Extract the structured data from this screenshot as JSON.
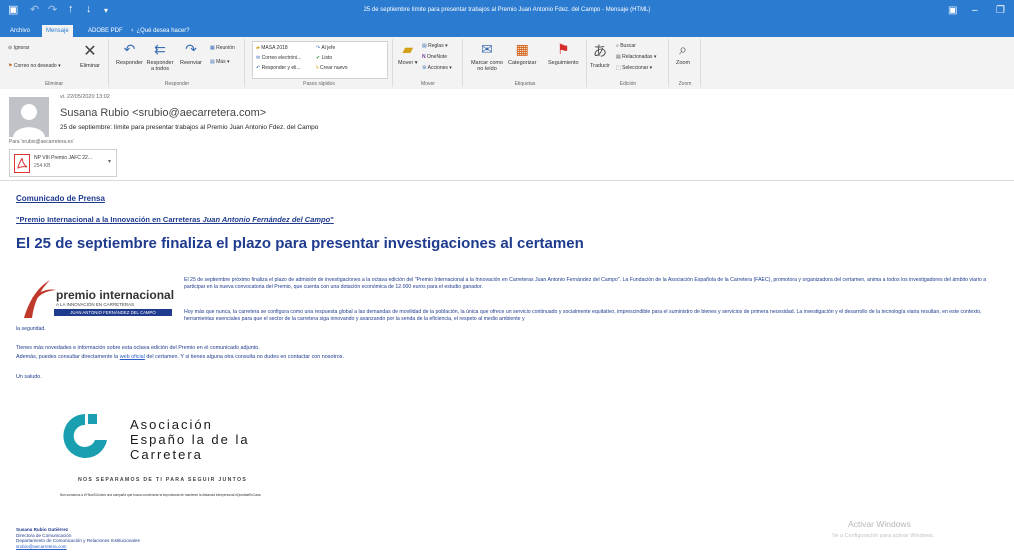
{
  "window": {
    "title": "25 de septiembre límite para presentar trabajos al Premio Juan Antonio Fdez. del Campo - Mensaje (HTML)"
  },
  "ribbon": {
    "tabs": [
      "Archivo",
      "Mensaje",
      "ADOBE PDF",
      "¿Qué desea hacer?"
    ],
    "active_tab": 1,
    "groups": {
      "eliminar": {
        "label": "Eliminar",
        "ignorar": "Ignorar",
        "correo_no_deseado": "Correo no deseado",
        "eliminar": "Eliminar"
      },
      "responder": {
        "label": "Responder",
        "responder": "Responder",
        "responder_todos": "Responder a todos",
        "reenviar": "Reenviar",
        "reunion": "Reunión",
        "mas": "Más"
      },
      "pasos": {
        "label": "Pasos rápidos",
        "items": [
          "MASA 2018",
          "Correo electróni...",
          "Responder y eli...",
          "Al jefe",
          "Listo",
          "Crear nuevo"
        ]
      },
      "mover": {
        "label": "Mover",
        "mover": "Mover",
        "reglas": "Reglas",
        "onenote": "OneNote",
        "acciones": "Acciones"
      },
      "etiquetas": {
        "label": "Etiquetas",
        "marcar": "Marcar como no leído",
        "categorizar": "Categorizar",
        "seguimiento": "Seguimiento"
      },
      "edicion": {
        "label": "Edición",
        "traducir": "Traducir",
        "buscar": "Buscar",
        "relacionadas": "Relacionadas",
        "seleccionar": "Seleccionar"
      },
      "zoom": {
        "label": "Zoom",
        "zoom": "Zoom"
      }
    }
  },
  "message": {
    "date": "vi. 22/05/2020 13:02",
    "sender": "Susana Rubio <srubio@aecarretera.com>",
    "subject": "25 de septiembre: límite para presentar trabajos al Premio Juan Antonio Fdez. del Campo",
    "to": "Para   'srubio@aecarretera.es'",
    "attachment": {
      "name": "NP VIII Premio JAFC 22...",
      "size": "254 KB"
    }
  },
  "body": {
    "press_label": "Comunicado de Prensa",
    "prize_prefix": "\"Premio Internacional a la Innovación en Carreteras ",
    "prize_name": "Juan Antonio Fernández del Campo",
    "prize_suffix": "\"",
    "headline": "El 25 de septiembre finaliza el plazo para presentar investigaciones al certamen",
    "logo": {
      "line1": "premio internacional",
      "line2": "A LA INNOVACIÓN EN CARRETERAS",
      "line3": "JUAN ANTONIO FERNÁNDEZ DEL CAMPO"
    },
    "para1": "El 25 de septiembre próximo finaliza el plazo de admisión de investigaciones a la octava edición del \"Premio Internacional a la Innovación en Carreteras Juan Antonio Fernández del Campo\". La Fundación de la Asociación Española de la Carretera (FAEC), promotora y organizadora del certamen, anima a todos los investigadores del ámbito viario a participar en la nueva convocatoria del Premio, que cuenta con una dotación económica de 12.000 euros para el estudio ganador.",
    "para2a": "Hoy más que nunca, la carretera se configura como una respuesta global a las demandas de movilidad de la población, la única que ofrece un servicio continuado y socialmente equitativo, imprescindible para el suministro de bienes y servicios de primera necesidad. La investigación y el desarrollo de la tecnología viaria resultan, en este contexto, herramientas esenciales para que el sector de la carretera siga innovando y avanzando por la senda de la eficiencia, el respeto al medio ambiente y",
    "para2b": "la seguridad.",
    "more_info": "Tienes más novedades e información sobre esta octava edición del Premio en el comunicado adjunto.",
    "web_prefix": "Además, puedes consultar directamente la ",
    "web_link": "web oficial",
    "web_suffix": " del certamen. Y si tienes alguna otra consulta no dudes en contactar con nosotros.",
    "greeting": "Un saludo.",
    "assoc_lines": [
      "Asociación",
      "Españo la de la",
      "Carretera"
    ],
    "slogan": "NOS SEPARAMOS DE TI PARA SEGUIR JUNTOS",
    "tiny_line": "Nos sumamos a #YNosSIJuntos una campaña que busca concienciar la importancia de mantener la distancia interpersonal #QuedateEnCasa",
    "signature": [
      "Susana Rubio Gutiérrez",
      "Directora de Comunicación",
      "Departamento de Comunicación y Relaciones Institucionales",
      "srubio@aecarretera.com"
    ]
  },
  "watermark": {
    "line1": "Activar Windows",
    "line2": "Ve a Configuración para activar Windows."
  },
  "colors": {
    "outlook_blue": "#2b7bd0",
    "brand_navy": "#1f3b8e",
    "brand_teal": "#1a9fb0",
    "logo_red": "#c0392b"
  }
}
